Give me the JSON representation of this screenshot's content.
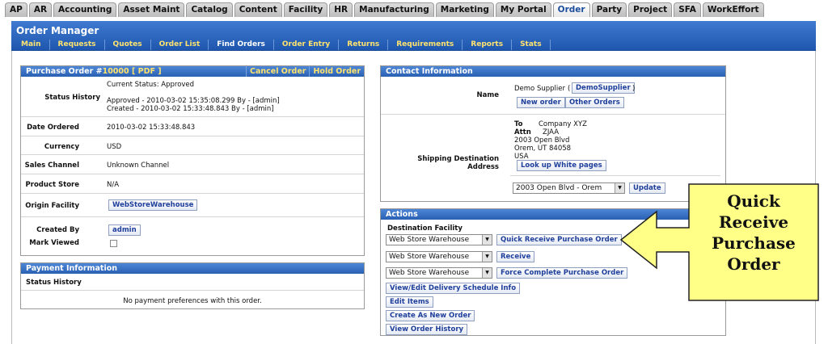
{
  "app_tabs": [
    "AP",
    "AR",
    "Accounting",
    "Asset Maint",
    "Catalog",
    "Content",
    "Facility",
    "HR",
    "Manufacturing",
    "Marketing",
    "My Portal",
    "Order",
    "Party",
    "Project",
    "SFA",
    "WorkEffort"
  ],
  "header": {
    "title": "Order Manager",
    "subnav": [
      "Main",
      "Requests",
      "Quotes",
      "Order List",
      "Find Orders",
      "Order Entry",
      "Returns",
      "Requirements",
      "Reports",
      "Stats"
    ]
  },
  "purchase_order": {
    "title_prefix": "Purchase Order #",
    "order_id": "10000",
    "pdf_link": "[ PDF ]",
    "cancel_label": "Cancel Order",
    "hold_label": "Hold Order",
    "status_history_label": "Status History",
    "current_status": "Current Status: Approved",
    "approved_line": "Approved - 2010-03-02 15:35:08.299   By - [admin]",
    "created_line": "Created - 2010-03-02 15:33:48.843   By - [admin]",
    "date_ordered_label": "Date Ordered",
    "date_ordered": "2010-03-02 15:33:48.843",
    "currency_label": "Currency",
    "currency": "USD",
    "sales_channel_label": "Sales Channel",
    "sales_channel": "Unknown Channel",
    "product_store_label": "Product Store",
    "product_store": "N/A",
    "origin_facility_label": "Origin Facility",
    "origin_facility": "WebStoreWarehouse",
    "created_by_label": "Created By",
    "created_by": "admin",
    "mark_viewed_label": "Mark Viewed"
  },
  "payment": {
    "title": "Payment Information",
    "status_history_label": "Status History",
    "empty_message": "No payment preferences with this order."
  },
  "contact": {
    "title": "Contact Information",
    "name_label": "Name",
    "name_value": "Demo Supplier",
    "party_id": "DemoSupplier",
    "new_order_label": "New order",
    "other_orders_label": "Other Orders",
    "shipping_label": "Shipping Destination Address",
    "to_label": "To",
    "to_value": "Company XYZ",
    "attn_label": "Attn",
    "attn_value": "ZJAA",
    "address1": "2003 Open Blvd",
    "address2": "Orem, UT 84058",
    "country": "USA",
    "white_pages_label": "Look up White pages",
    "address_select": "2003 Open Blvd - Orem",
    "update_label": "Update"
  },
  "actions": {
    "title": "Actions",
    "destination_facility_label": "Destination Facility",
    "facility_select_1": "Web Store Warehouse",
    "facility_select_2": "Web Store Warehouse",
    "facility_select_3": "Web Store Warehouse",
    "quick_receive_label": "Quick Receive Purchase Order",
    "receive_label": "Receive",
    "force_complete_label": "Force Complete Purchase Order",
    "delivery_schedule_label": "View/Edit Delivery Schedule Info",
    "edit_items_label": "Edit Items",
    "create_new_label": "Create As New Order",
    "view_history_label": "View Order History"
  },
  "callout": {
    "line1": "Quick",
    "line2": "Receive",
    "line3": "Purchase",
    "line4": "Order",
    "fill": "#ffff88",
    "stroke": "#222222"
  },
  "colors": {
    "header_blue": "#2a60b3",
    "nav_text": "#ffe36e",
    "link_blue": "#1f3f9b"
  }
}
